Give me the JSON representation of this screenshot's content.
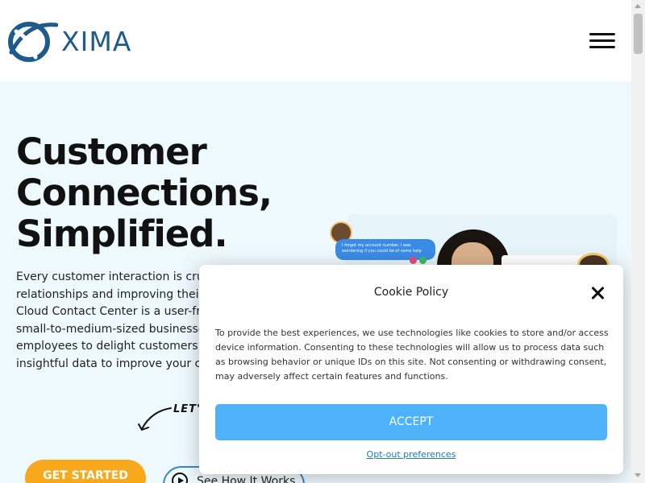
{
  "header": {
    "logo_text": "XIMA",
    "brand_color": "#1e5a8c",
    "menu_icon": "hamburger-menu-icon"
  },
  "hero": {
    "title_lines": [
      "Customer",
      "Connections,",
      "Simplified."
    ],
    "body_lines": [
      "Every customer interaction is crucia",
      "relationships and improving their ex",
      "Cloud Contact Center is a user-frien",
      "small-to-medium-sized businesses",
      "employees to delight customers wh",
      "insightful data to improve your com"
    ],
    "lets_text": "LET'S",
    "get_started_label": "GET STARTED",
    "see_how_label": "See How It Works",
    "background_color": "#eef9fd",
    "primary_color": "#f7a81b"
  },
  "illustration": {
    "chat_lines": [
      "I forgot my account number. I was",
      "wondering if you could be of some help",
      "with this?"
    ]
  },
  "cookie_modal": {
    "title": "Cookie Policy",
    "text_lines": [
      "To provide the best experiences, we use technologies like cookies to store and/or access",
      "device information. Consenting to these technologies will allow us to process data such",
      "as browsing behavior or unique IDs on this site. Not consenting or withdrawing consent,",
      "may adversely affect certain features and functions."
    ],
    "accept_label": "ACCEPT",
    "optout_label": "Opt-out preferences",
    "accept_color": "#4db2f7"
  }
}
